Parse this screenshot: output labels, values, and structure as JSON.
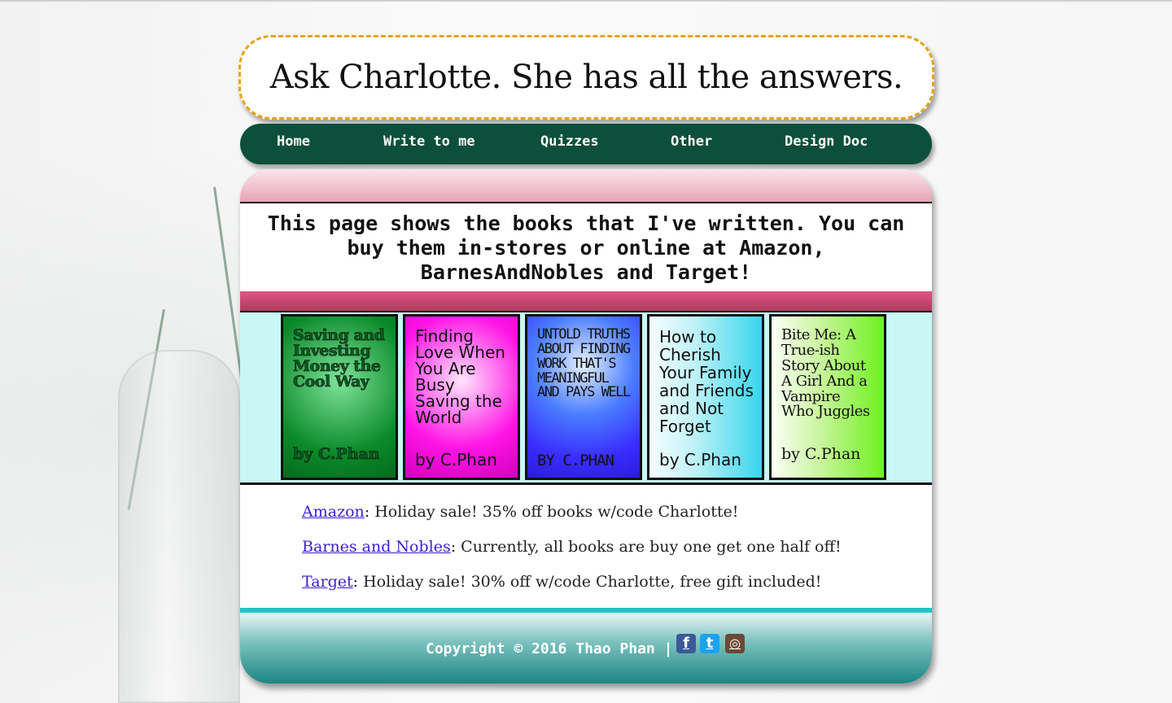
{
  "header": {
    "title": "Ask Charlotte. She has all the answers."
  },
  "nav": {
    "items": [
      {
        "label": "Home"
      },
      {
        "label": "Write to me"
      },
      {
        "label": "Quizzes"
      },
      {
        "label": "Other"
      },
      {
        "label": "Design Doc"
      }
    ]
  },
  "intro": {
    "text": "This page shows the books that I've written. You can buy them in-stores or online at Amazon, BarnesAndNobles and Target!"
  },
  "books": [
    {
      "title": "Saving and Investing Money the Cool Way",
      "author": "by C.Phan",
      "color": "#0b8a2a"
    },
    {
      "title": "Finding Love When You Are Busy Saving the World",
      "author": "by C.Phan",
      "color": "#ff14e6"
    },
    {
      "title": "Untold Truths About Finding Work That's Meaningful and Pays Well",
      "author": "by C.Phan",
      "color": "#3a2cff"
    },
    {
      "title": "How to Cherish Your Family and Friends and Not Forget",
      "author": "by C.Phan",
      "color": "#36d6ec"
    },
    {
      "title": "Bite Me: A True-ish Story About A Girl And a Vampire Who Juggles",
      "author": "by C.Phan",
      "color": "#6ef21e"
    }
  ],
  "stores": [
    {
      "link": "Amazon",
      "text": ": Holiday sale! 35% off books w/code Charlotte!"
    },
    {
      "link": "Barnes and Nobles",
      "text": ": Currently, all books are buy one get one half off!"
    },
    {
      "link": "Target",
      "text": ": Holiday sale! 30% off w/code Charlotte, free gift included!"
    }
  ],
  "footer": {
    "copyright": "Copyright © 2016 Thao Phan |",
    "icons": [
      {
        "name": "facebook-icon",
        "glyph": "f",
        "color": "#3b5998"
      },
      {
        "name": "twitter-icon",
        "glyph": "t",
        "color": "#1da1f2"
      },
      {
        "name": "instagram-icon",
        "glyph": "◎",
        "color": "#6b4a36"
      }
    ]
  }
}
